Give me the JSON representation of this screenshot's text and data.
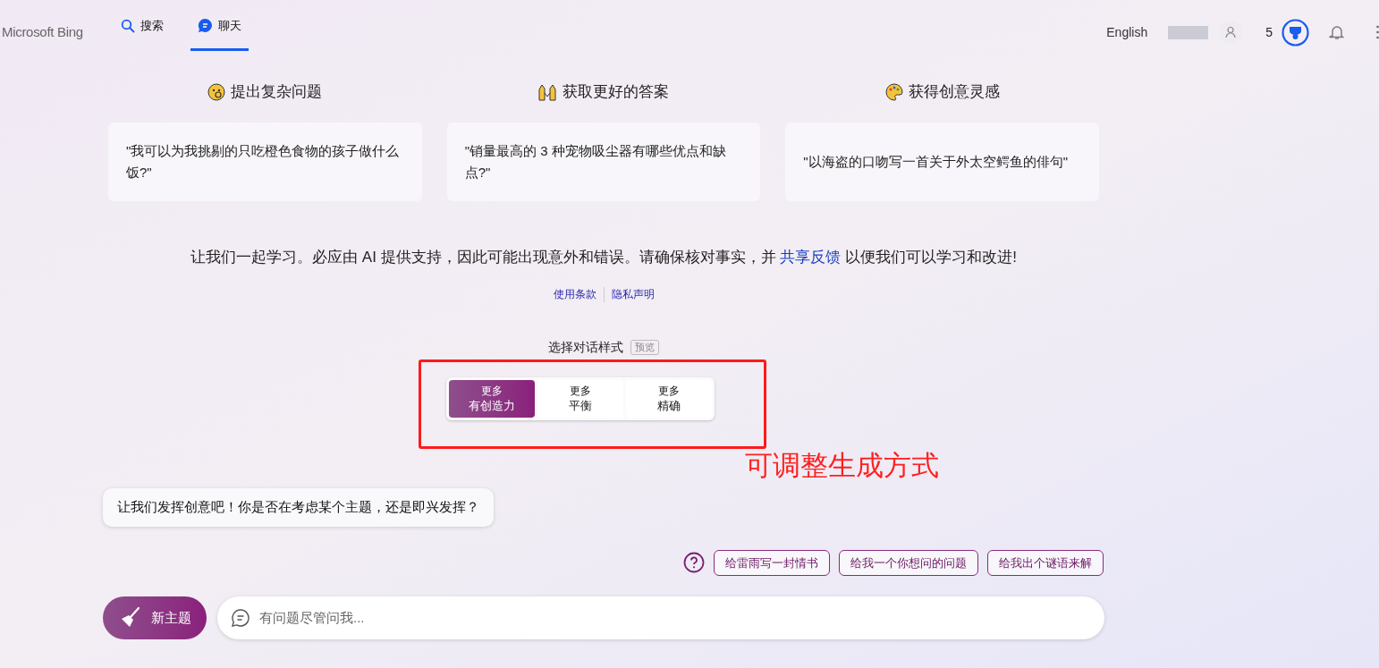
{
  "header": {
    "logo": "Microsoft Bing",
    "tabs": [
      {
        "label": "搜索",
        "selected": false
      },
      {
        "label": "聊天",
        "selected": true
      }
    ],
    "language": "English",
    "points": "5"
  },
  "prompts": [
    {
      "title": "提出复杂问题",
      "example": "\"我可以为我挑剔的只吃橙色食物的孩子做什么饭?\""
    },
    {
      "title": "获取更好的答案",
      "example": "\"销量最高的 3 种宠物吸尘器有哪些优点和缺点?\""
    },
    {
      "title": "获得创意灵感",
      "example": "\"以海盗的口吻写一首关于外太空鳄鱼的俳句\""
    }
  ],
  "disclaimer": {
    "before": "让我们一起学习。必应由 AI 提供支持，因此可能出现意外和错误。请确保核对事实，并",
    "link": "共享反馈",
    "after": "以便我们可以学习和改进!"
  },
  "legal_links": [
    "使用条款",
    "隐私声明"
  ],
  "style_picker": {
    "label": "选择对话样式",
    "badge": "预览",
    "options": [
      {
        "line1": "更多",
        "line2": "有创造力",
        "selected": true
      },
      {
        "line1": "更多",
        "line2": "平衡",
        "selected": false
      },
      {
        "line1": "更多",
        "line2": "精确",
        "selected": false
      }
    ]
  },
  "annotation": "可调整生成方式",
  "bot_message": "让我们发挥创意吧！你是否在考虑某个主题，还是即兴发挥？",
  "suggestions": [
    "给雷雨写一封情书",
    "给我一个你想问的问题",
    "给我出个谜语来解"
  ],
  "new_topic": "新主题",
  "input": {
    "placeholder": "有问题尽管问我..."
  }
}
